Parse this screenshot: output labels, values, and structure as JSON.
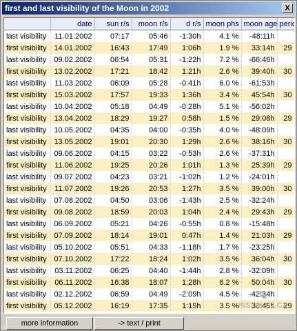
{
  "window": {
    "title": "first and last visibility of the Moon in 2002",
    "close_glyph": "X"
  },
  "table": {
    "columns": [
      "",
      "date",
      "sun r/s",
      "moon r/s",
      "d r/s",
      "moon phs",
      "moon age",
      "period"
    ],
    "rows": [
      [
        "last visibility",
        "11.01.2002",
        "07:17",
        "05:46",
        "-1:30h",
        "4.1 %",
        "-48:11h",
        ""
      ],
      [
        "first visibility",
        "14.01.2002",
        "16:43",
        "17:49",
        "1:06h",
        "1.9 %",
        "33:14h",
        "29"
      ],
      [
        "last visibility",
        "09.02.2002",
        "06:54",
        "05:31",
        "-1:22h",
        "7.2 %",
        "-66:46h",
        ""
      ],
      [
        "first visibility",
        "13.02.2002",
        "17:21",
        "18:42",
        "1:21h",
        "2.6 %",
        "39:40h",
        "30"
      ],
      [
        "last visibility",
        "11.03.2002",
        "06:09",
        "05:28",
        "-0:41h",
        "6.0 %",
        "-61:53h",
        ""
      ],
      [
        "first visibility",
        "15.03.2002",
        "17:57",
        "19:33",
        "1:36h",
        "3.4 %",
        "45:54h",
        "30"
      ],
      [
        "last visibility",
        "10.04.2002",
        "05:18",
        "04:49",
        "-0:28h",
        "5.1 %",
        "-56:02h",
        ""
      ],
      [
        "first visibility",
        "13.04.2002",
        "18:29",
        "19:27",
        "0:58h",
        "1.5 %",
        "29:08h",
        "29"
      ],
      [
        "last visibility",
        "10.05.2002",
        "04:35",
        "04:00",
        "-0:35h",
        "4.0 %",
        "-48:09h",
        ""
      ],
      [
        "first visibility",
        "13.05.2002",
        "19:01",
        "20:30",
        "1:29h",
        "2.6 %",
        "38:16h",
        "30"
      ],
      [
        "last visibility",
        "09.06.2002",
        "04:15",
        "03:22",
        "-0:53h",
        "2.6 %",
        "-37:31h",
        ""
      ],
      [
        "first visibility",
        "11.06.2002",
        "19:25",
        "20:26",
        "1:01h",
        "1.3 %",
        "25:39h",
        "29"
      ],
      [
        "last visibility",
        "09.07.2002",
        "04:23",
        "03:21",
        "-1:02h",
        "1.2 %",
        "-24:01h",
        ""
      ],
      [
        "first visibility",
        "11.07.2002",
        "19:26",
        "20:53",
        "1:27h",
        "3.5 %",
        "39:00h",
        "30"
      ],
      [
        "last visibility",
        "07.08.2002",
        "04:50",
        "03:06",
        "-1:43h",
        "2.5 %",
        "-32:24h",
        ""
      ],
      [
        "first visibility",
        "09.08.2002",
        "18:59",
        "20:03",
        "1:04h",
        "2.4 %",
        "29:43h",
        "29"
      ],
      [
        "last visibility",
        "06.09.2002",
        "05:21",
        "04:26",
        "-0:55h",
        "0.8 %",
        "-15:48h",
        ""
      ],
      [
        "first visibility",
        "07.09.2002",
        "18:14",
        "19:01",
        "0:47h",
        "1.4 %",
        "21:03h",
        "29"
      ],
      [
        "last visibility",
        "05.10.2002",
        "05:51",
        "04:33",
        "-1:18h",
        "1.7 %",
        "-23:25h",
        ""
      ],
      [
        "first visibility",
        "07.10.2002",
        "17:22",
        "18:24",
        "1:02h",
        "3.5 %",
        "36:04h",
        "30"
      ],
      [
        "last visibility",
        "03.11.2002",
        "06:25",
        "04:40",
        "-1:44h",
        "2.8 %",
        "-32:09h",
        ""
      ],
      [
        "first visibility",
        "06.11.2002",
        "16:38",
        "18:07",
        "1:28h",
        "6.2 %",
        "50:04h",
        "30"
      ],
      [
        "last visibility",
        "02.12.2002",
        "06:59",
        "04:49",
        "-2:09h",
        "4.5 %",
        "-42:34h",
        ""
      ],
      [
        "first visibility",
        "05.12.2002",
        "16:19",
        "17:35",
        "1:15h",
        "3.5 %",
        "38:45h",
        "29"
      ]
    ]
  },
  "buttons": {
    "more_info": "more information",
    "text_print": "-> text / print"
  },
  "watermark": {
    "text": "INSTALUJ.CZ",
    "icon": "arrow-watermark-icon"
  }
}
